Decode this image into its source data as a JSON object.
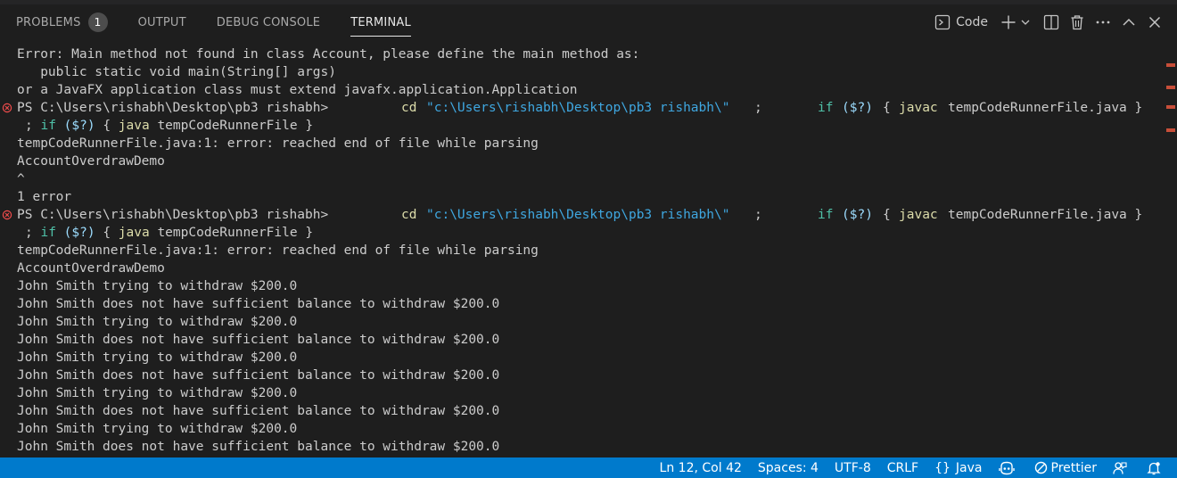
{
  "panel": {
    "tabs": [
      {
        "label": "PROBLEMS",
        "badge": "1"
      },
      {
        "label": "OUTPUT"
      },
      {
        "label": "DEBUG CONSOLE"
      },
      {
        "label": "TERMINAL",
        "active": true
      }
    ],
    "actions": {
      "terminal_label": "Code",
      "icons": [
        "terminal-icon",
        "plus-icon",
        "chevron-down-icon",
        "split-icon",
        "trash-icon",
        "more-icon",
        "chevron-up-icon",
        "close-icon"
      ]
    }
  },
  "terminal": {
    "lines": [
      {
        "text": "Error: Main method not found in class Account, please define the main method as:"
      },
      {
        "text": "   public static void main(String[] args)"
      },
      {
        "text": "or a JavaFX application class must extend javafx.application.Application"
      },
      {
        "prompt": "PS C:\\Users\\rishabh\\Desktop\\pb3 rishabh>",
        "error": true,
        "cmd1": "cd",
        "str1": "\"c:\\Users\\rishabh\\Desktop\\pb3 rishabh\\\"",
        "sep1": ";",
        "kw1": "if",
        "var1": "($?)",
        "cmd2": "javac",
        "arg2": "tempCodeRunnerFile.java }"
      },
      {
        "cont": true,
        "sep": ";",
        "kw": "if",
        "var": "($?)",
        "cmd": "java",
        "arg": "tempCodeRunnerFile }"
      },
      {
        "text": "tempCodeRunnerFile.java:1: error: reached end of file while parsing"
      },
      {
        "text": "AccountOverdrawDemo"
      },
      {
        "text": "^"
      },
      {
        "text": "1 error"
      },
      {
        "prompt": "PS C:\\Users\\rishabh\\Desktop\\pb3 rishabh>",
        "error": true,
        "cmd1": "cd",
        "str1": "\"c:\\Users\\rishabh\\Desktop\\pb3 rishabh\\\"",
        "sep1": ";",
        "kw1": "if",
        "var1": "($?)",
        "cmd2": "javac",
        "arg2": "tempCodeRunnerFile.java }"
      },
      {
        "cont": true,
        "sep": ";",
        "kw": "if",
        "var": "($?)",
        "cmd": "java",
        "arg": "tempCodeRunnerFile }"
      },
      {
        "text": "tempCodeRunnerFile.java:1: error: reached end of file while parsing"
      },
      {
        "text": "AccountOverdrawDemo"
      },
      {
        "text": "John Smith trying to withdraw $200.0"
      },
      {
        "text": "John Smith does not have sufficient balance to withdraw $200.0"
      },
      {
        "text": "John Smith trying to withdraw $200.0"
      },
      {
        "text": "John Smith does not have sufficient balance to withdraw $200.0"
      },
      {
        "text": "John Smith trying to withdraw $200.0"
      },
      {
        "text": "John Smith does not have sufficient balance to withdraw $200.0"
      },
      {
        "text": "John Smith trying to withdraw $200.0"
      },
      {
        "text": "John Smith does not have sufficient balance to withdraw $200.0"
      },
      {
        "text": "John Smith trying to withdraw $200.0"
      },
      {
        "text": "John Smith does not have sufficient balance to withdraw $200.0"
      }
    ]
  },
  "statusbar": {
    "position": "Ln 12, Col 42",
    "spaces": "Spaces: 4",
    "encoding": "UTF-8",
    "eol": "CRLF",
    "language_braces": "{}",
    "language": "Java",
    "prettier": "Prettier"
  },
  "colors": {
    "statusbar": "#007acc",
    "error": "#f14c4c",
    "command": "#dcdcaa",
    "string": "#ce9178",
    "path": "#3fa7e0",
    "keyword": "#4fc1a8",
    "variable": "#9cdcfe"
  }
}
